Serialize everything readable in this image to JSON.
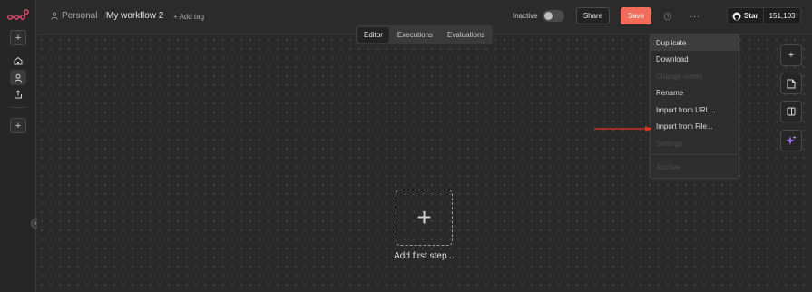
{
  "app": {
    "project": "Personal",
    "workflow_title": "My workflow 2",
    "add_tag": "+ Add tag"
  },
  "header": {
    "status_label": "Inactive",
    "share_label": "Share",
    "save_label": "Save",
    "more_label": "···",
    "github": {
      "star_label": "Star",
      "star_count": "151,103"
    }
  },
  "tabs": [
    {
      "label": "Editor",
      "active": true
    },
    {
      "label": "Executions",
      "active": false
    },
    {
      "label": "Evaluations",
      "active": false
    }
  ],
  "menu": {
    "items": [
      {
        "label": "Duplicate",
        "state": "hover"
      },
      {
        "label": "Download",
        "state": "normal"
      },
      {
        "label": "Change owner",
        "state": "disabled"
      },
      {
        "label": "Rename",
        "state": "normal"
      },
      {
        "label": "Import from URL...",
        "state": "normal"
      },
      {
        "label": "Import from File...",
        "state": "normal"
      },
      {
        "label": "Settings",
        "state": "disabled"
      },
      {
        "label": "Archive",
        "state": "disabled"
      }
    ]
  },
  "canvas": {
    "add_first_label": "Add first step..."
  },
  "colors": {
    "accent": "#f26b5b",
    "background": "#2a2a2a",
    "annotation_arrow": "#e8321e"
  },
  "icons": {
    "logo": "n8n-logo-icon",
    "sidebar": [
      "plus-icon",
      "home-icon",
      "user-icon",
      "share-icon",
      "plus-icon"
    ],
    "tools": [
      "plus-icon",
      "sticky-note-icon",
      "panel-icon",
      "sparkles-icon"
    ]
  }
}
